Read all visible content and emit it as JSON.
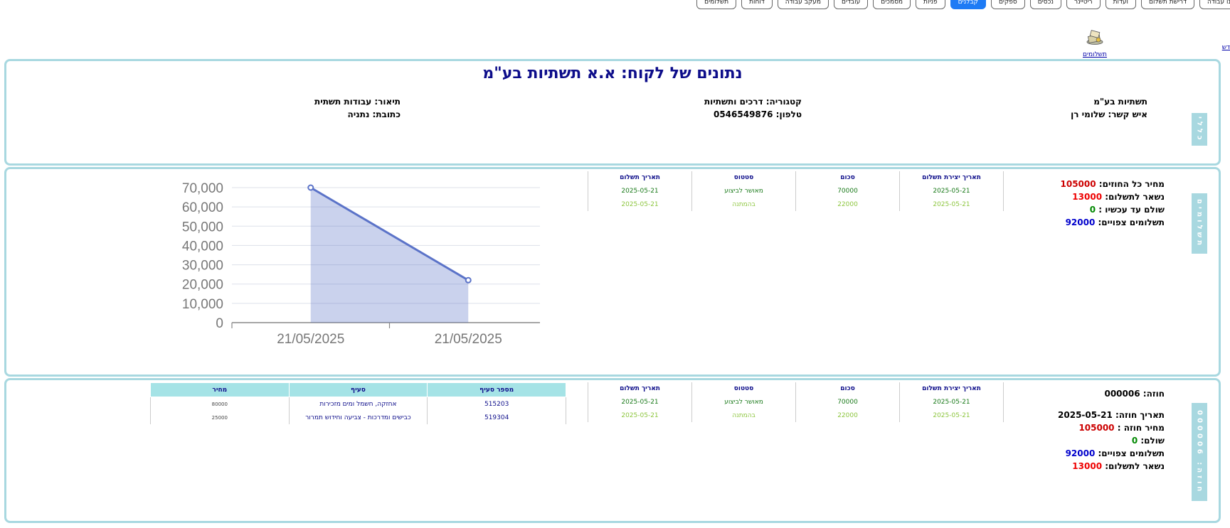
{
  "nav": [
    {
      "label": "נו עבודה",
      "active": false
    },
    {
      "label": "דרישת תשלום",
      "active": false
    },
    {
      "label": "ועדות",
      "active": false
    },
    {
      "label": "ריטיינר",
      "active": false
    },
    {
      "label": "נכסים",
      "active": false
    },
    {
      "label": "ספקים",
      "active": false
    },
    {
      "label": "קבלנים",
      "active": true
    },
    {
      "label": "פניות",
      "active": false
    },
    {
      "label": "מסמכים",
      "active": false
    },
    {
      "label": "עובדים",
      "active": false
    },
    {
      "label": "מעקב עבודה",
      "active": false
    },
    {
      "label": "דוחות",
      "active": false
    },
    {
      "label": "תשלומים",
      "active": false
    }
  ],
  "links": {
    "payments": "תשלומים",
    "new": "דש"
  },
  "client": {
    "side_tab": "כללי",
    "title": "נתונים של לקוח: א.א תשתיות בע\"מ",
    "name": "תשתיות בע\"מ",
    "contact": "איש קשר: שלומי רן",
    "category": "קטגוריה: דרכים ותשתיות",
    "phone": "טלפון: 0546549876",
    "description": "תיאור: עבודות תשתית",
    "address": "כתובת: נתניה"
  },
  "payments": {
    "side_tab": "תשלומים",
    "summary": {
      "total_label": "מחיר כל החוזים:",
      "total": "105000",
      "remaining_label": "נשאר לתשלום:",
      "remaining": "13000",
      "paid_label": "שולם עד עכשיו :",
      "paid": "0",
      "expected_label": "תשלומים צפויים:",
      "expected": "92000"
    },
    "headers": [
      "תאריך יצירת תשלום",
      "סכום",
      "סטטוס",
      "תאריך תשלום"
    ],
    "rows": [
      {
        "created": "2025-05-21",
        "amount": "70000",
        "status": "מאושר לביצוע",
        "date": "2025-05-21",
        "kind": "ok"
      },
      {
        "created": "2025-05-21",
        "amount": "22000",
        "status": "בהמתנה",
        "date": "2025-05-21",
        "kind": "wait"
      }
    ]
  },
  "chart_data": {
    "type": "area",
    "categories": [
      "21/05/2025",
      "21/05/2025"
    ],
    "values": [
      70000,
      22000
    ],
    "ylim": [
      0,
      70000
    ],
    "yticks": [
      "0",
      "10,000",
      "20,000",
      "30,000",
      "40,000",
      "50,000",
      "60,000",
      "70,000"
    ],
    "grid": true,
    "color": "#5b73c8"
  },
  "contract": {
    "side_tab": "חוזה: 000006",
    "number_label": "חוזה:",
    "number": "000006",
    "date_label": "תאריך חוזה:",
    "date": "2025-05-21",
    "price_label": "מחיר חוזה :",
    "price": "105000",
    "paid_label": "שולם:",
    "paid": "0",
    "expected_label": "תשלומים צפויים:",
    "expected": "92000",
    "remaining_label": "נשאר לתשלום:",
    "remaining": "13000",
    "item_headers": [
      "מספר סעיף",
      "סעיף",
      "מחיר"
    ],
    "items": [
      {
        "num": "515203",
        "desc": "אחזקה, חשמל ומים מזכירות",
        "price": "80000"
      },
      {
        "num": "519304",
        "desc": "כבישים ומדרכות - צביעה וחידוש תמרור",
        "price": "25000"
      }
    ]
  }
}
